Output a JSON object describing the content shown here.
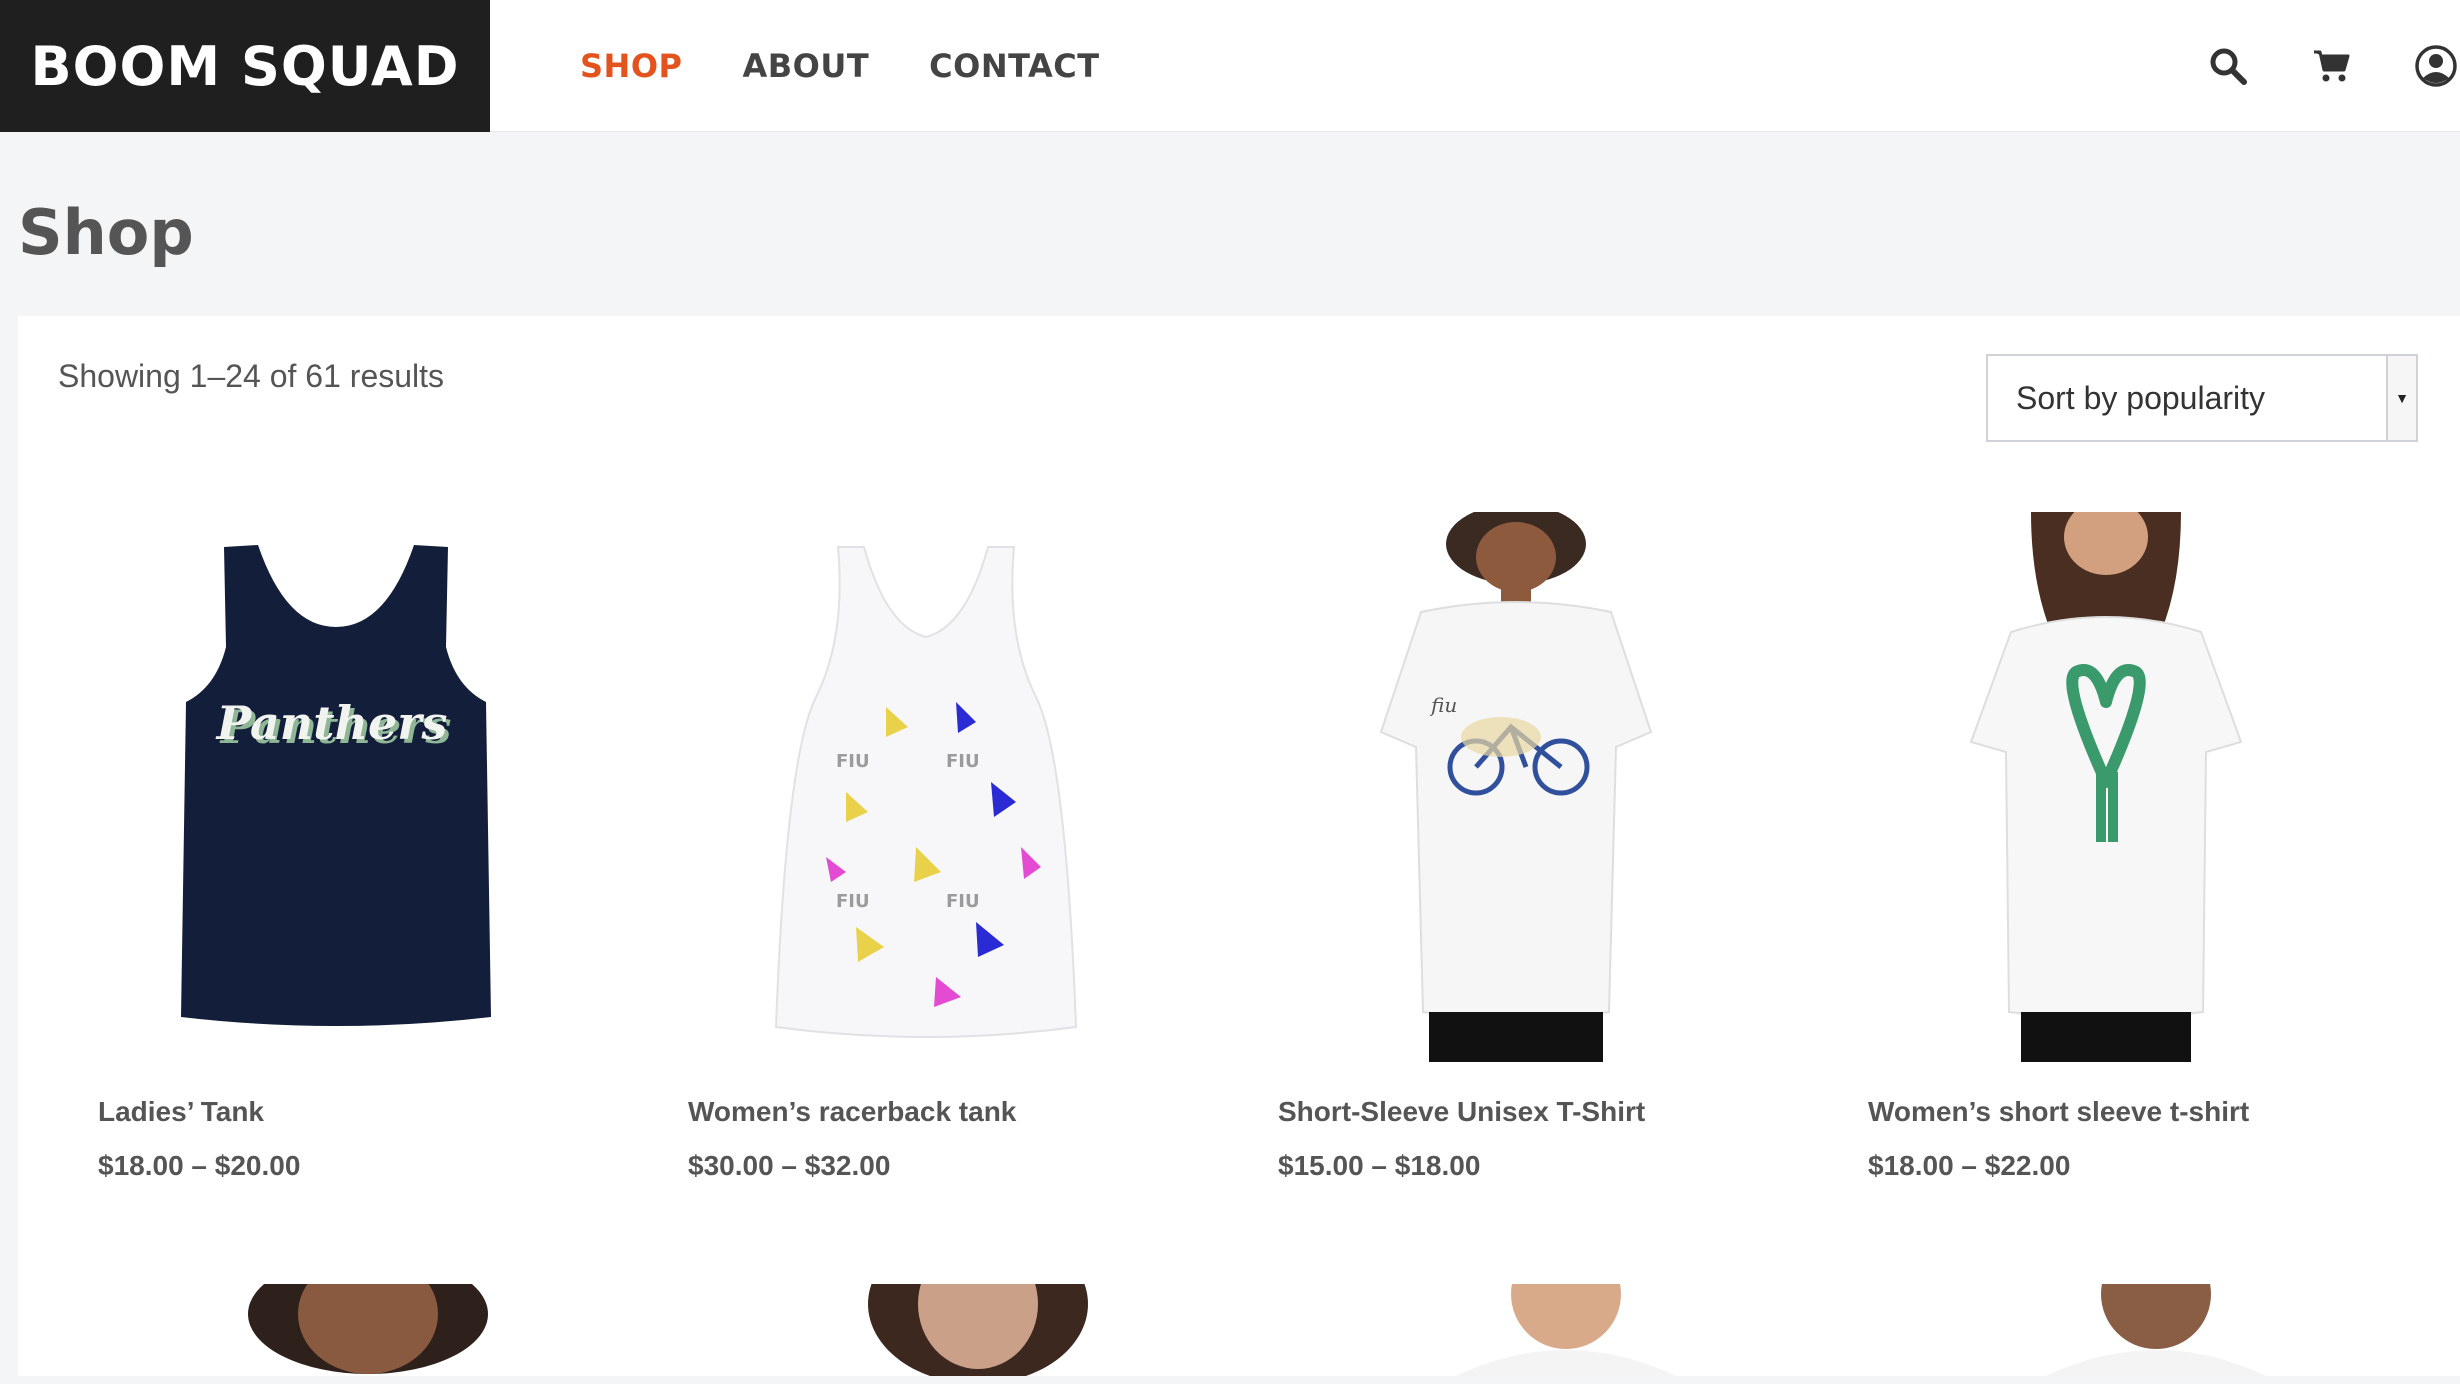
{
  "brand": "BOOM SQUAD",
  "nav": {
    "shop": "SHOP",
    "about": "ABOUT",
    "contact": "CONTACT"
  },
  "icons": [
    "search-icon",
    "cart-icon",
    "account-icon"
  ],
  "colors": {
    "accent": "#e3531e",
    "brand_bg": "#1f1f1f"
  },
  "page": {
    "title": "Shop"
  },
  "results_text": "Showing 1–24 of 61 results",
  "sort": {
    "selected": "Sort by popularity"
  },
  "products": [
    {
      "title": "Ladies’ Tank",
      "price": "$18.00 – $20.00"
    },
    {
      "title": "Women’s racerback tank",
      "price": "$30.00 – $32.00"
    },
    {
      "title": "Short-Sleeve Unisex T-Shirt",
      "price": "$15.00 – $18.00"
    },
    {
      "title": "Women’s short sleeve t-shirt",
      "price": "$18.00 – $22.00"
    }
  ],
  "thumb_text": {
    "tank_print": "Panthers",
    "fiu_tag": "FIU",
    "bike_tag": "fiu"
  }
}
